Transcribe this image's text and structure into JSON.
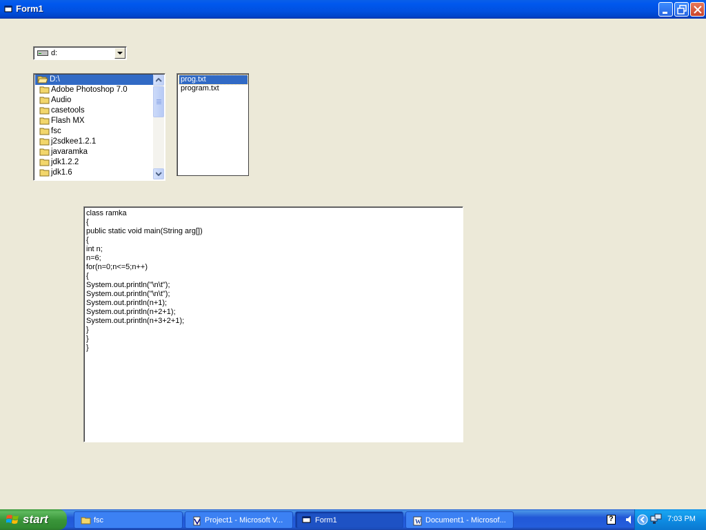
{
  "window": {
    "title": "Form1"
  },
  "drive_combo": {
    "value": "d:"
  },
  "directory_list": {
    "items": [
      {
        "label": "D:\\",
        "selected": true,
        "open": true
      },
      {
        "label": "Adobe Photoshop 7.0"
      },
      {
        "label": "Audio"
      },
      {
        "label": "casetools"
      },
      {
        "label": "Flash MX"
      },
      {
        "label": "fsc"
      },
      {
        "label": "j2sdkee1.2.1"
      },
      {
        "label": "javaramka"
      },
      {
        "label": "jdk1.2.2"
      },
      {
        "label": "jdk1.6"
      }
    ]
  },
  "file_list": {
    "items": [
      {
        "label": "prog.txt",
        "selected": true
      },
      {
        "label": "program.txt"
      }
    ]
  },
  "code_text": {
    "lines": [
      "class ramka",
      "{",
      "public static void main(String arg[])",
      "{",
      "int n;",
      "n=6;",
      "for(n=0;n<=5;n++)",
      "{",
      "System.out.println(\"\\n\\t\");",
      "System.out.println(\"\\n\\t\");",
      "System.out.println(n+1);",
      "System.out.println(n+2+1);",
      "System.out.println(n+3+2+1);",
      "}",
      "}",
      "}"
    ]
  },
  "taskbar": {
    "start_label": "start",
    "tasks": [
      {
        "label": "fsc",
        "icon": "folder-icon"
      },
      {
        "label": "Project1 - Microsoft V...",
        "icon": "vb-icon"
      },
      {
        "label": "Form1",
        "icon": "form-icon",
        "active": true
      },
      {
        "label": "Document1 - Microsof...",
        "icon": "word-icon"
      }
    ],
    "clock": "7:03 PM"
  },
  "colors": {
    "selection": "#316AC5",
    "window_bg": "#ECE9D8",
    "titlebar": "#0054E3",
    "taskbar": "#245EDC",
    "start": "#3A963A"
  }
}
